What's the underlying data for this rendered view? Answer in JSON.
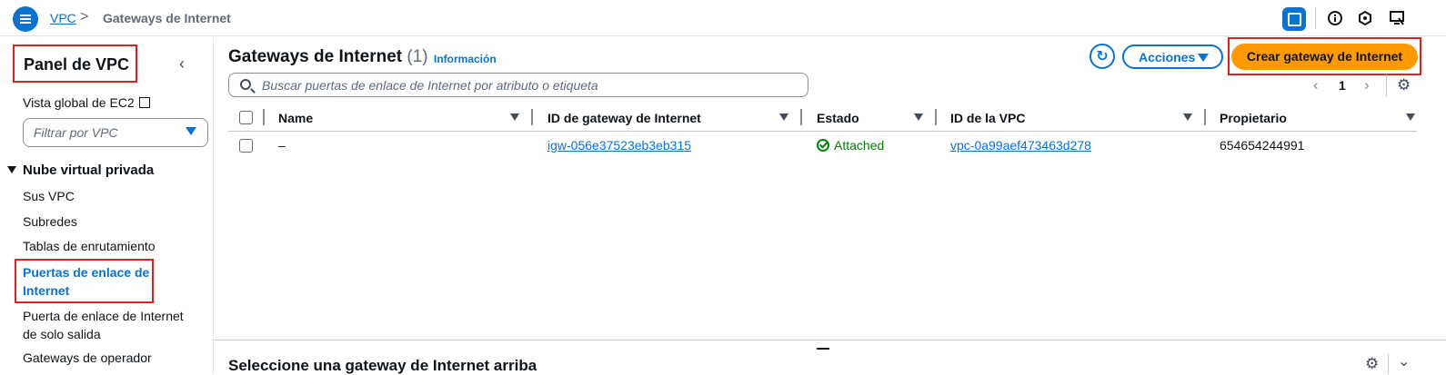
{
  "breadcrumb": {
    "service": "VPC",
    "separator": ">",
    "current": "Gateways de Internet"
  },
  "sidebar": {
    "title": "Panel de VPC",
    "ec2_link": "Vista global de EC2",
    "filter_placeholder": "Filtrar por VPC",
    "section": "Nube virtual privada",
    "items": [
      {
        "label": "Sus VPC"
      },
      {
        "label": "Subredes"
      },
      {
        "label": "Tablas de enrutamiento"
      },
      {
        "label": "Puertas de enlace de Internet"
      },
      {
        "label": "Puerta de enlace de Internet de solo salida"
      },
      {
        "label": "Gateways de operador"
      }
    ]
  },
  "main": {
    "title": "Gateways de Internet",
    "count": "(1)",
    "info": "Información",
    "actions_label": "Acciones",
    "create_label": "Crear gateway de Internet",
    "search_placeholder": "Buscar puertas de enlace de Internet por atributo o etiqueta",
    "page": "1",
    "columns": [
      "Name",
      "ID de gateway de Internet",
      "Estado",
      "ID de la VPC",
      "Propietario"
    ],
    "rows": [
      {
        "name": "–",
        "gateway_id": "igw-056e37523eb3eb315",
        "state": "Attached",
        "vpc_id": "vpc-0a99aef473463d278",
        "owner": "654654244991"
      }
    ]
  },
  "bottom": {
    "title": "Seleccione una gateway de Internet arriba"
  },
  "colors": {
    "accent": "#0972d3",
    "primary_button": "#ff9900",
    "success": "#037f0c",
    "highlight_box": "#e02020"
  },
  "icons": [
    "menu-icon",
    "chevron-right-icon",
    "panel-icon",
    "info-icon",
    "settings-hex-icon",
    "notifications-icon",
    "chevron-left-icon",
    "external-link-icon",
    "caret-down-icon",
    "search-icon",
    "refresh-icon",
    "gear-icon",
    "check-circle-icon",
    "chevron-down-icon"
  ]
}
